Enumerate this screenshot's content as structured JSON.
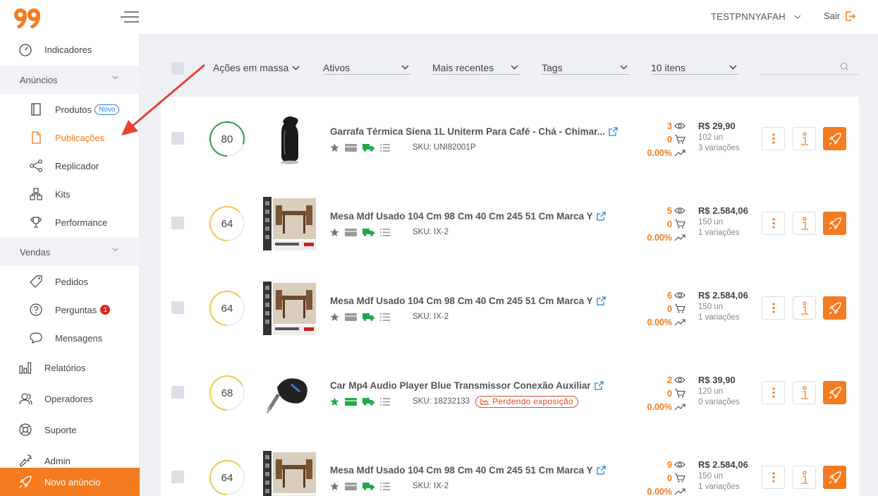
{
  "header": {
    "user_name": "TESTPNNYAFAH",
    "logout_label": "Sair"
  },
  "sidebar": {
    "indicadores": "Indicadores",
    "anuncios_group": "Anúncios",
    "produtos": "Produtos",
    "novo_badge": "Novo",
    "publicacoes": "Publicações",
    "replicador": "Replicador",
    "kits": "Kits",
    "performance": "Performance",
    "vendas_group": "Vendas",
    "pedidos": "Pedidos",
    "perguntas": "Perguntas",
    "perguntas_count": "1",
    "mensagens": "Mensagens",
    "relatorios": "Relatórios",
    "operadores": "Operadores",
    "suporte": "Suporte",
    "admin": "Admin",
    "novo_anuncio": "Novo anúncio"
  },
  "filters": {
    "bulk_actions": "Ações em massa",
    "status": "Ativos",
    "sort": "Mais recentes",
    "tags": "Tags",
    "page_size": "10 itens",
    "search_placeholder": ""
  },
  "colors": {
    "accent": "#f47b20",
    "score_green": "#2e9e3e",
    "score_yellow": "#f2c94c",
    "ship_green": "#1faa4a",
    "link_blue": "#2a7fd4",
    "warning_red": "#e04a2a"
  },
  "listings": [
    {
      "score": "80",
      "title": "Garrafa Térmica Siena 1L Uniterm Para Café - Chá - Chimar...",
      "sku": "SKU: UNI82001P",
      "views": "3",
      "cart": "0",
      "conversion": "0.00%",
      "price": "R$ 29,90",
      "units": "102 un",
      "variations": "3 variações",
      "warning": ""
    },
    {
      "score": "64",
      "title": "Mesa Mdf Usado 104 Cm 98 Cm 40 Cm 245 51 Cm Marca Y",
      "sku": "SKU: IX-2",
      "views": "5",
      "cart": "0",
      "conversion": "0.00%",
      "price": "R$ 2.584,06",
      "units": "150 un",
      "variations": "1 variações",
      "warning": ""
    },
    {
      "score": "64",
      "title": "Mesa Mdf Usado 104 Cm 98 Cm 40 Cm 245 51 Cm Marca Y",
      "sku": "SKU: IX-2",
      "views": "6",
      "cart": "0",
      "conversion": "0.00%",
      "price": "R$ 2.584,06",
      "units": "150 un",
      "variations": "1 variações",
      "warning": ""
    },
    {
      "score": "68",
      "title": "Car Mp4 Audio Player Blue Transmissor Conexão Auxiliar",
      "sku": "SKU: 18232133",
      "views": "2",
      "cart": "0",
      "conversion": "0.00%",
      "price": "R$ 39,90",
      "units": "120 un",
      "variations": "0 variações",
      "warning": "Perdendo exposição"
    },
    {
      "score": "64",
      "title": "Mesa Mdf Usado 104 Cm 98 Cm 40 Cm 245 51 Cm Marca Y",
      "sku": "SKU: IX-2",
      "views": "9",
      "cart": "0",
      "conversion": "0.00%",
      "price": "R$ 2.584,06",
      "units": "150 un",
      "variations": "1 variações",
      "warning": ""
    }
  ],
  "icons": {
    "views": "eye-icon",
    "cart": "cart-icon",
    "trend": "trend-icon",
    "external": "external-link-icon",
    "more": "more-vertical-icon",
    "info": "info-icon",
    "boost": "rocket-icon"
  }
}
